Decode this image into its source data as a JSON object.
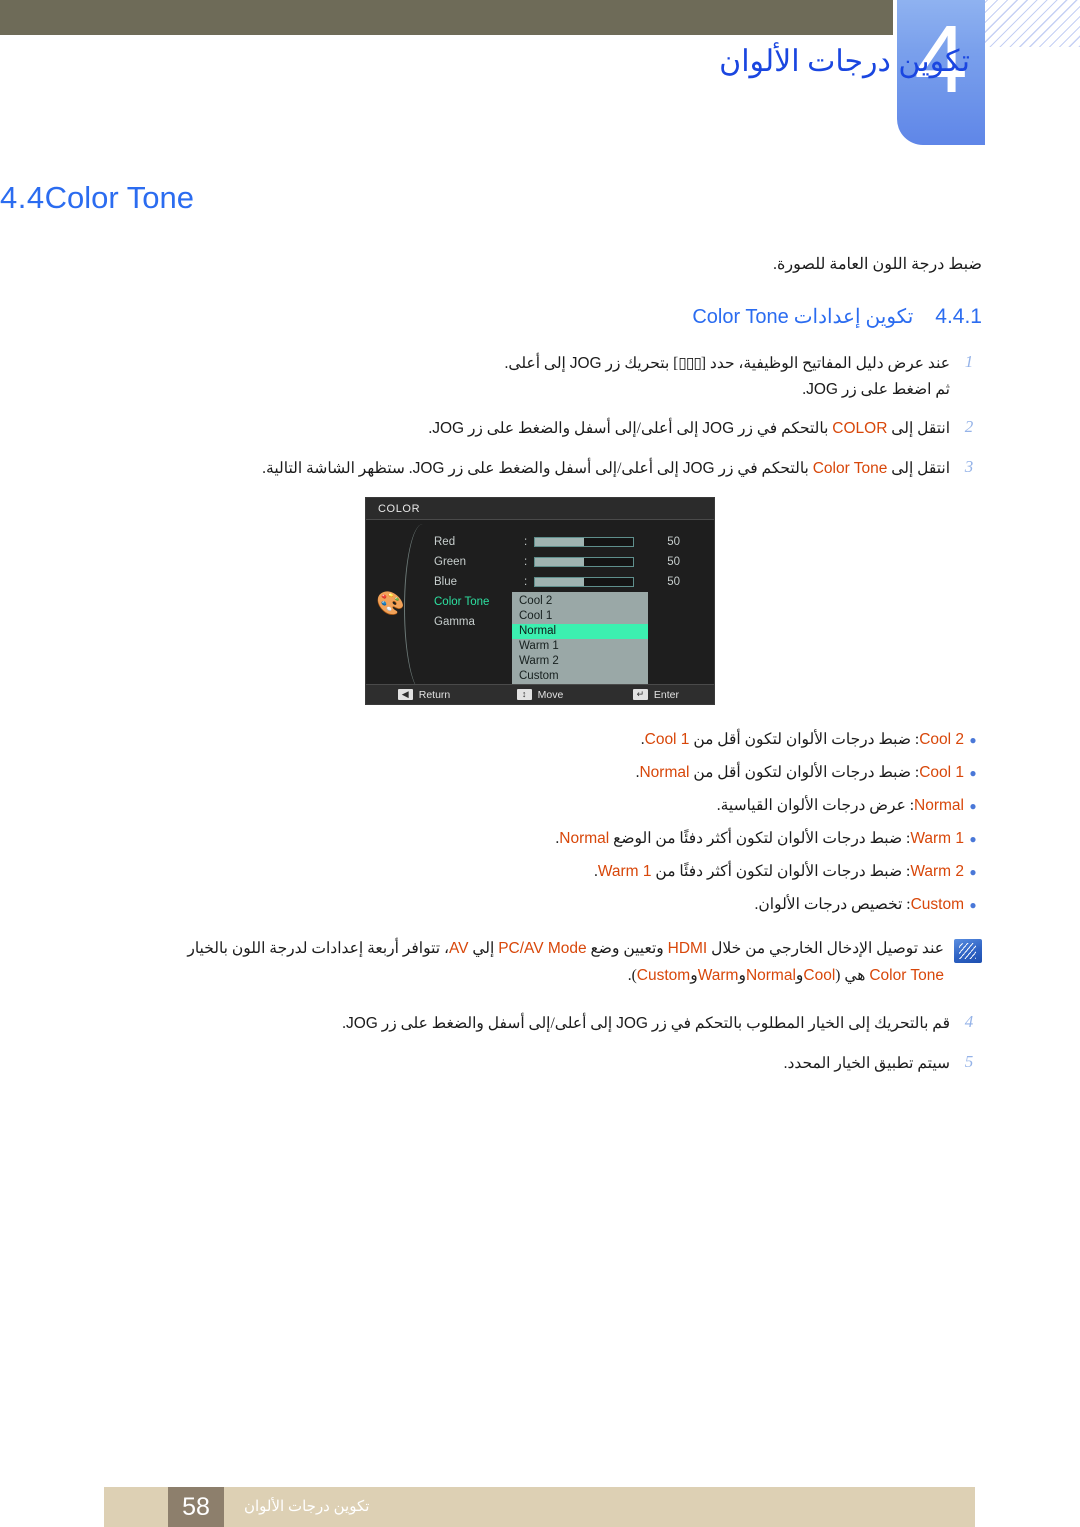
{
  "chapter": {
    "number": "4",
    "title": "تكوين درجات الألوان"
  },
  "section": {
    "number": "4.4",
    "name": "Color Tone",
    "lead": "ضبط درجة اللون العامة للصورة."
  },
  "subsection": {
    "number": "4.4.1",
    "title_ar": "تكوين إعدادات",
    "title_en": "Color Tone"
  },
  "steps": [
    {
      "num": "1",
      "line1_a": "عند عرض دليل المفاتيح الوظيفية، حدد [",
      "glyph": "▯▯▯",
      "line1_b": "] بتحريك زر",
      "key": "JOG",
      "line1_c": "إلى أعلى.",
      "line2_a": "ثم اضغط على زر",
      "line2_key": "JOG",
      "line2_b": "."
    },
    {
      "num": "2",
      "a": "انتقل إلى",
      "kw": "COLOR",
      "b": "بالتحكم في زر",
      "key1": "JOG",
      "c": "إلى أعلى/إلى أسفل والضغط على زر",
      "key2": "JOG",
      "d": "."
    },
    {
      "num": "3",
      "a": "انتقل إلى",
      "kw": "Color Tone",
      "b": "بالتحكم في زر",
      "key1": "JOG",
      "c": "إلى أعلى/إلى أسفل والضغط على زر",
      "key2": "JOG",
      "d": ". ستظهر الشاشة التالية."
    }
  ],
  "steps_tail": [
    {
      "num": "4",
      "a": "قم بالتحريك إلى الخيار المطلوب بالتحكم في زر",
      "key1": "JOG",
      "b": "إلى أعلى/إلى أسفل والضغط على زر",
      "key2": "JOG",
      "c": "."
    },
    {
      "num": "5",
      "a": "سيتم تطبيق الخيار المحدد.",
      "key1": "",
      "b": "",
      "key2": "",
      "c": ""
    }
  ],
  "osd": {
    "title": "COLOR",
    "palette_icon": "palette-icon",
    "rows": [
      {
        "label": "Red",
        "value": "50",
        "fill_pct": 50,
        "type": "slider",
        "active": false
      },
      {
        "label": "Green",
        "value": "50",
        "fill_pct": 50,
        "type": "slider",
        "active": false
      },
      {
        "label": "Blue",
        "value": "50",
        "fill_pct": 50,
        "type": "slider",
        "active": false
      },
      {
        "label": "Color Tone",
        "value": "",
        "fill_pct": 0,
        "type": "menu",
        "active": true
      },
      {
        "label": "Gamma",
        "value": "",
        "fill_pct": 0,
        "type": "menu",
        "active": false
      }
    ],
    "dropdown": {
      "items": [
        "Cool 2",
        "Cool 1",
        "Normal",
        "Warm 1",
        "Warm 2",
        "Custom"
      ],
      "selected": "Normal"
    },
    "footer": [
      {
        "key": "◀",
        "label": "Return",
        "icon": "left-arrow-key-icon"
      },
      {
        "key": "↕",
        "label": "Move",
        "icon": "updown-arrow-key-icon"
      },
      {
        "key": "↵",
        "label": "Enter",
        "icon": "enter-key-icon"
      }
    ],
    "colors": {
      "background": "#1e1e1e",
      "highlight": "#3cf0b0",
      "active_label": "#2de0a0",
      "dropdown_bg": "#9aa8a7"
    }
  },
  "bullets": [
    {
      "name": "Cool 2",
      "text_a": ": ضبط درجات الألوان لتكون أقل من",
      "ref": "Cool 1",
      "text_b": "."
    },
    {
      "name": "Cool 1",
      "text_a": ": ضبط درجات الألوان لتكون أقل من",
      "ref": "Normal",
      "text_b": "."
    },
    {
      "name": "Normal",
      "text_a": ": عرض درجات الألوان القياسية.",
      "ref": "",
      "text_b": ""
    },
    {
      "name": "Warm 1",
      "text_a": ": ضبط درجات الألوان لتكون أكثر دفئًا من الوضع",
      "ref": "Normal",
      "text_b": "."
    },
    {
      "name": "Warm 2",
      "text_a": ": ضبط درجات الألوان لتكون أكثر دفئًا من",
      "ref": "Warm 1",
      "text_b": "."
    },
    {
      "name": "Custom",
      "text_a": ": تخصيص درجات الألوان.",
      "ref": "",
      "text_b": ""
    }
  ],
  "note": {
    "icon": "note-info-icon",
    "a": "عند توصيل الإدخال الخارجي من خلال",
    "k1": "HDMI",
    "b": "وتعيين وضع",
    "k2": "PC/AV Mode",
    "c": "إلي",
    "k3": "AV",
    "d": "، تتوافر أربعة إعدادات لدرجة اللون",
    "e": "بالخيار",
    "k4": "Color Tone",
    "f": "هي (",
    "k5": "Cool",
    "g": "و",
    "k6": "Normal",
    "h": "و",
    "k7": "Warm",
    "i": "و",
    "k8": "Custom",
    "j": ")."
  },
  "footer": {
    "page": "58",
    "text": "تكوين درجات الألوان"
  },
  "theme": {
    "accent_blue": "#2b6cf0",
    "keyword_orange": "#d8470a",
    "khaki": "#6e6b58",
    "footer_bg": "#ddd0b4",
    "footer_page_bg": "#8d7f6c",
    "tab_blue": "#7aa0ec"
  }
}
